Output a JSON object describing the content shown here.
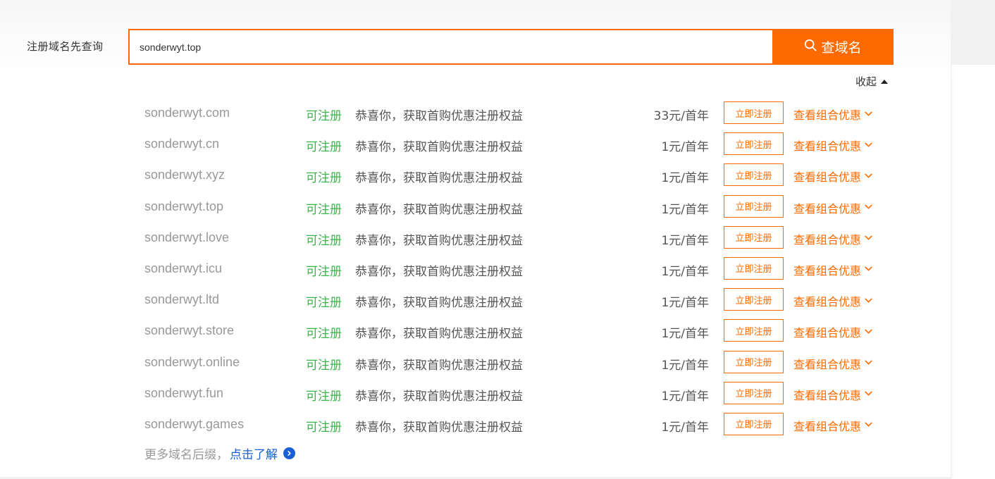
{
  "search": {
    "label": "注册域名先查询",
    "value": "sonderwyt.top",
    "button_label": "查域名"
  },
  "collapse_label": "收起",
  "results": [
    {
      "domain": "sonderwyt.com",
      "status": "可注册",
      "promo": "恭喜你，获取首购优惠注册权益",
      "price": "33元/首年",
      "register_label": "立即注册",
      "bundle_label": "查看组合优惠"
    },
    {
      "domain": "sonderwyt.cn",
      "status": "可注册",
      "promo": "恭喜你，获取首购优惠注册权益",
      "price": "1元/首年",
      "register_label": "立即注册",
      "bundle_label": "查看组合优惠"
    },
    {
      "domain": "sonderwyt.xyz",
      "status": "可注册",
      "promo": "恭喜你，获取首购优惠注册权益",
      "price": "1元/首年",
      "register_label": "立即注册",
      "bundle_label": "查看组合优惠"
    },
    {
      "domain": "sonderwyt.top",
      "status": "可注册",
      "promo": "恭喜你，获取首购优惠注册权益",
      "price": "1元/首年",
      "register_label": "立即注册",
      "bundle_label": "查看组合优惠"
    },
    {
      "domain": "sonderwyt.love",
      "status": "可注册",
      "promo": "恭喜你，获取首购优惠注册权益",
      "price": "1元/首年",
      "register_label": "立即注册",
      "bundle_label": "查看组合优惠"
    },
    {
      "domain": "sonderwyt.icu",
      "status": "可注册",
      "promo": "恭喜你，获取首购优惠注册权益",
      "price": "1元/首年",
      "register_label": "立即注册",
      "bundle_label": "查看组合优惠"
    },
    {
      "domain": "sonderwyt.ltd",
      "status": "可注册",
      "promo": "恭喜你，获取首购优惠注册权益",
      "price": "1元/首年",
      "register_label": "立即注册",
      "bundle_label": "查看组合优惠"
    },
    {
      "domain": "sonderwyt.store",
      "status": "可注册",
      "promo": "恭喜你，获取首购优惠注册权益",
      "price": "1元/首年",
      "register_label": "立即注册",
      "bundle_label": "查看组合优惠"
    },
    {
      "domain": "sonderwyt.online",
      "status": "可注册",
      "promo": "恭喜你，获取首购优惠注册权益",
      "price": "1元/首年",
      "register_label": "立即注册",
      "bundle_label": "查看组合优惠"
    },
    {
      "domain": "sonderwyt.fun",
      "status": "可注册",
      "promo": "恭喜你，获取首购优惠注册权益",
      "price": "1元/首年",
      "register_label": "立即注册",
      "bundle_label": "查看组合优惠"
    },
    {
      "domain": "sonderwyt.games",
      "status": "可注册",
      "promo": "恭喜你，获取首购优惠注册权益",
      "price": "1元/首年",
      "register_label": "立即注册",
      "bundle_label": "查看组合优惠"
    }
  ],
  "more": {
    "text": "更多域名后缀，",
    "link_label": "点击了解"
  },
  "colors": {
    "accent": "#ff6a00",
    "available": "#3cb34a",
    "link": "#1a5fd6"
  },
  "icons": {
    "search_button": "search-icon",
    "collapse": "caret-up-icon",
    "bundle": "chevron-down-icon",
    "more": "arrow-right-circle-icon"
  }
}
